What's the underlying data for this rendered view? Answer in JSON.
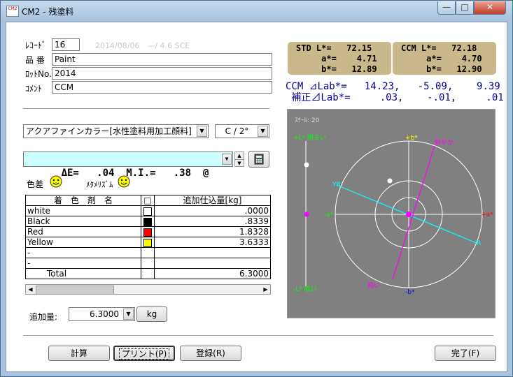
{
  "window": {
    "title": "CM2 - 残塗料",
    "icon": "cm2-app-icon",
    "min_glyph": "—",
    "max_glyph": "□",
    "close_glyph": "✕"
  },
  "info": {
    "record_label": "ﾚｺｰﾄﾞ",
    "record_value": "16",
    "record_meta": "2014/08/06　—/ 4.6 SCE",
    "product_label": "品 番",
    "product_value": "Paint",
    "lot_label": "ﾛｯﾄNo.",
    "lot_value": "2014",
    "comment_label": "ｺﾒﾝﾄ",
    "comment_value": "CCM"
  },
  "std_box": {
    "line1": "STD L*=   72.15",
    "line2": "     a*=    4.71",
    "line3": "     b*=   12.89"
  },
  "ccm_box": {
    "line1": "CCM L*=   72.18",
    "line2": "     a*=    4.70",
    "line3": "     b*=   12.90"
  },
  "ccm_delta": "CCM ⊿Lab*=   14.23,   -5.09,    9.39",
  "corr_delta": " 補正⊿Lab*=     .03,    -.01,     .01",
  "paint_combo": "アクアファインカラー[水性塗料用加工顔料]",
  "light_combo": "C / 2°",
  "de_line": "ΔE=   .04  M.I.=   .38  @",
  "color_diff_label": "色差",
  "metamerism_label": "ﾒﾀﾒﾘｽﾞﾑ",
  "table": {
    "headers": [
      "着　色　剤　名",
      "□",
      "追加仕込量[kg]"
    ],
    "rows": [
      {
        "name": "white",
        "color": "#ffffff",
        "value": ".0000"
      },
      {
        "name": "Black",
        "color": "#000000",
        "value": ".8339"
      },
      {
        "name": "Red",
        "color": "#ff0000",
        "value": "1.8328"
      },
      {
        "name": "Yellow",
        "color": "#ffff00",
        "value": "3.6333"
      },
      {
        "name": "-",
        "color": "",
        "value": ""
      },
      {
        "name": "-",
        "color": "",
        "value": ""
      },
      {
        "name": "Total",
        "color": "",
        "value": "6.3000"
      }
    ]
  },
  "add_amount": {
    "label": "追加量:",
    "value": "6.3000",
    "unit": "kg"
  },
  "buttons": {
    "calc": "計算",
    "print": "プリント(P)",
    "register": "登録(R)",
    "done": "完了(F)"
  },
  "plot": {
    "scale_label": "ｽｹｰﾙ: 20",
    "l_plus": "+L* 明るい",
    "l_minus": "-L* 暗い",
    "b_plus": "+b*",
    "b_minus": "-b*",
    "a_plus": "+a*",
    "a_minus": "-a*",
    "vivid": "鮮やか",
    "dull": "鈍い",
    "yr": "YR",
    "r": "R",
    "colors": {
      "axis_l": "#00ff00",
      "axis_b": "#ffff00",
      "axis_a": "#ff0000",
      "hue": "#00ffff",
      "chroma": "#ff00ff",
      "magenta": "#ff00ff",
      "white": "#ffffff",
      "blue": "#0000ff"
    }
  }
}
